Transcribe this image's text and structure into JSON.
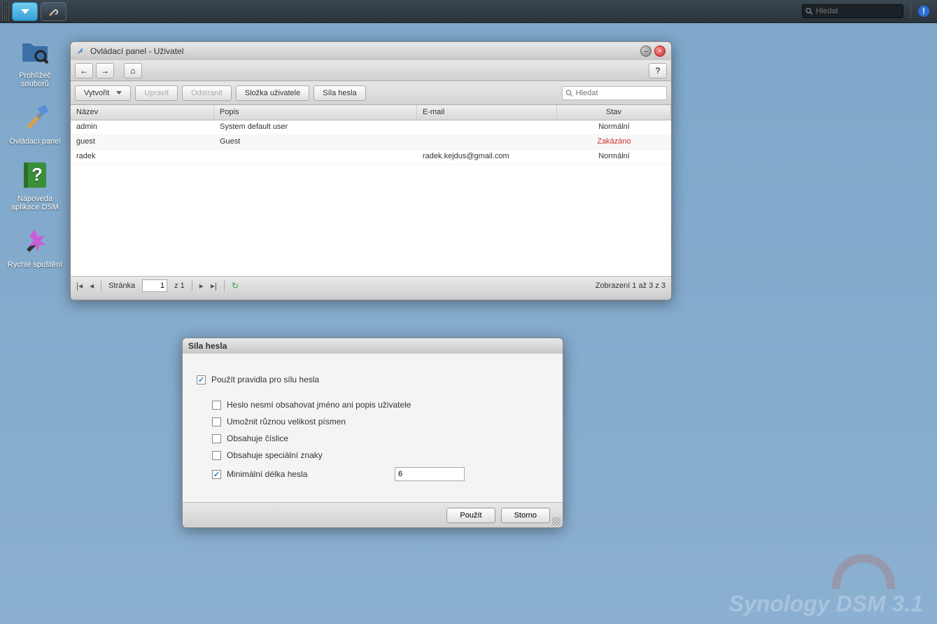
{
  "taskbar": {
    "search_placeholder": "Hledat"
  },
  "desktop": {
    "icons": [
      {
        "label": "Prohlížeč souborů"
      },
      {
        "label": "Ovládací panel"
      },
      {
        "label": "Nápoveda aplikace DSM"
      },
      {
        "label": "Rychlé spuštění"
      }
    ]
  },
  "window": {
    "title": "Ovládací panel - Uživatel",
    "toolbar": {
      "create": "Vytvořit",
      "edit": "Upravit",
      "delete": "Odstranit",
      "user_folder": "Složka uživatele",
      "password_strength": "Síla hesla",
      "search_placeholder": "Hledat"
    },
    "columns": {
      "name": "Název",
      "desc": "Popis",
      "email": "E-mail",
      "status": "Stav"
    },
    "rows": [
      {
        "name": "admin",
        "desc": "System default user",
        "email": "",
        "status": "Normální",
        "status_class": "normal"
      },
      {
        "name": "guest",
        "desc": "Guest",
        "email": "",
        "status": "Zakázáno",
        "status_class": "disabled"
      },
      {
        "name": "radek",
        "desc": "",
        "email": "radek.kejdus@gmail.com",
        "status": "Normální",
        "status_class": "normal"
      }
    ],
    "pager": {
      "page_label": "Stránka",
      "page_value": "1",
      "of_text": "z 1",
      "info": "Zobrazení 1 až 3 z 3"
    }
  },
  "dialog": {
    "title": "Síla hesla",
    "apply_rules": "Použít pravidla pro sílu hesla",
    "rule_no_name": "Heslo nesmí obsahovat jméno ani popis uživatele",
    "rule_case": "Umožnit různou velikost písmen",
    "rule_digits": "Obsahuje číslice",
    "rule_special": "Obsahuje speciální znaky",
    "rule_minlen": "Minimální délka hesla",
    "minlen_value": "6",
    "apply": "Použít",
    "cancel": "Storno"
  },
  "watermark": "Synology DSM 3.1"
}
